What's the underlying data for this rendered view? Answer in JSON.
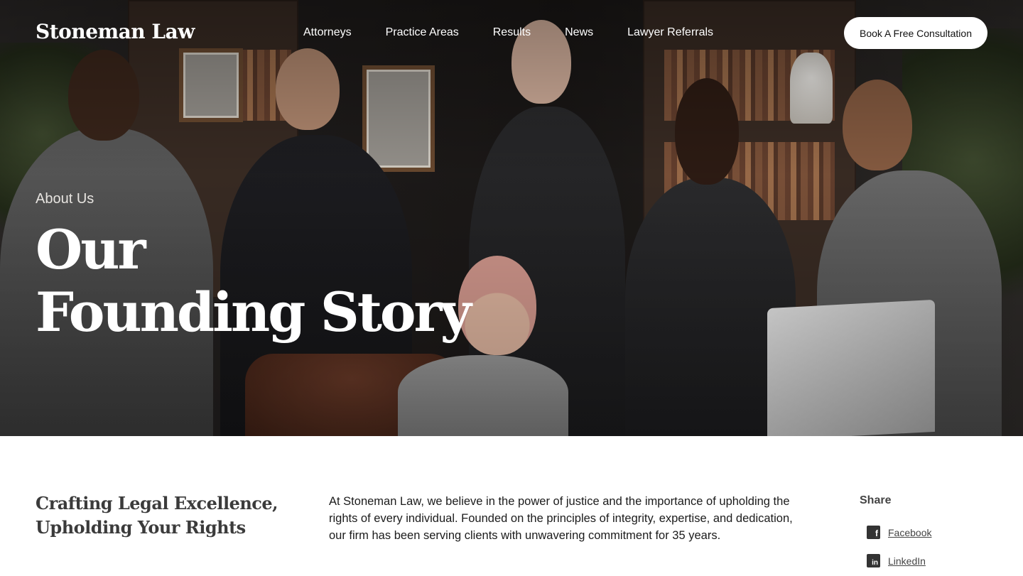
{
  "brand": {
    "logo": "Stoneman Law"
  },
  "nav": {
    "items": [
      {
        "label": "Attorneys"
      },
      {
        "label": "Practice Areas"
      },
      {
        "label": "Results"
      },
      {
        "label": "News"
      },
      {
        "label": "Lawyer Referrals"
      }
    ],
    "cta_label": "Book A Free Consultation"
  },
  "hero": {
    "eyebrow": "About Us",
    "title_line1": "Our",
    "title_line2": "Founding Story"
  },
  "content": {
    "subhead_line1": "Crafting Legal Excellence,",
    "subhead_line2": "Upholding Your Rights",
    "body": "At Stoneman Law, we believe in the power of justice and the importance of upholding the rights of every individual. Founded on the principles of integrity, expertise, and dedication, our firm has been serving clients with unwavering commitment for 35 years."
  },
  "share": {
    "title": "Share",
    "links": [
      {
        "label": "Facebook",
        "icon": "facebook-icon",
        "glyph": "f"
      },
      {
        "label": "LinkedIn",
        "icon": "linkedin-icon",
        "glyph": "in"
      }
    ]
  }
}
